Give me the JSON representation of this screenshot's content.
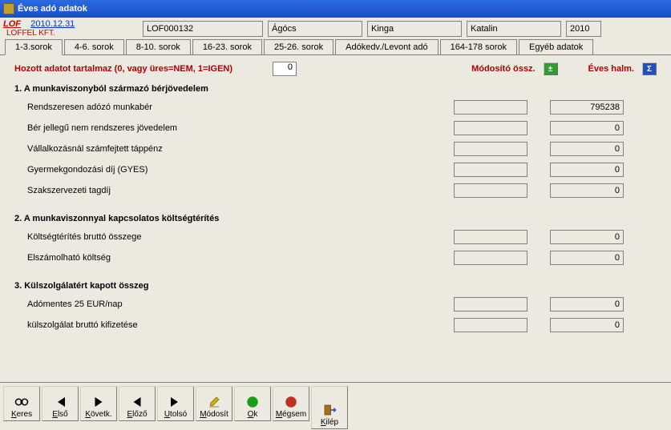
{
  "window": {
    "title": "Éves adó adatok"
  },
  "header": {
    "lof": "LOF",
    "date": "2010.12.31",
    "company": "LOFFEL KFT.",
    "code": "LOF000132",
    "last": "Ágócs",
    "first": "Kinga",
    "middle": "Katalin",
    "year": "2010"
  },
  "tabs": [
    "1-3.sorok",
    "4-6. sorok",
    "8-10. sorok",
    "16-23. sorok",
    "25-26. sorok",
    "Adókedv./Levont adó",
    "164-178 sorok",
    "Egyéb adatok"
  ],
  "redline": {
    "text": "Hozott adatot  tartalmaz (0, vagy üres=NEM, 1=IGEN)",
    "value": "0",
    "modosito": "Módosító össz.",
    "eves": "Éves halm."
  },
  "sections": {
    "s1": {
      "title": "1. A munkaviszonyból származó bérjövedelem",
      "rows": [
        {
          "label": "Rendszeresen adózó munkabér",
          "v1": "",
          "v2": "795238"
        },
        {
          "label": "Bér jellegű nem rendszeres jövedelem",
          "v1": "",
          "v2": "0"
        },
        {
          "label": "Vállalkozásnál számfejtett táppénz",
          "v1": "",
          "v2": "0"
        },
        {
          "label": "Gyermekgondozási díj (GYES)",
          "v1": "",
          "v2": "0"
        },
        {
          "label": "Szakszervezeti tagdíj",
          "v1": "",
          "v2": "0"
        }
      ]
    },
    "s2": {
      "title": "2. A munkaviszonnyal kapcsolatos költségtérítés",
      "rows": [
        {
          "label": "Költségtérítés bruttó összege",
          "v1": "",
          "v2": "0"
        },
        {
          "label": "Elszámolható költség",
          "v1": "",
          "v2": "0"
        }
      ]
    },
    "s3": {
      "title": "3. Külszolgálatért kapott összeg",
      "rows": [
        {
          "label": "Adómentes 25 EUR/nap",
          "v1": "",
          "v2": "0"
        },
        {
          "label": "külszolgálat bruttó kifizetése",
          "v1": "",
          "v2": "0"
        }
      ]
    }
  },
  "footer": {
    "keres": "Keres",
    "elso": "Első",
    "kovetk": "Követk.",
    "elozo": "Előző",
    "utolso": "Utolsó",
    "modosit": "Módosít",
    "ok": "Ok",
    "megsem": "Mégsem",
    "kilep": "Kilép"
  }
}
